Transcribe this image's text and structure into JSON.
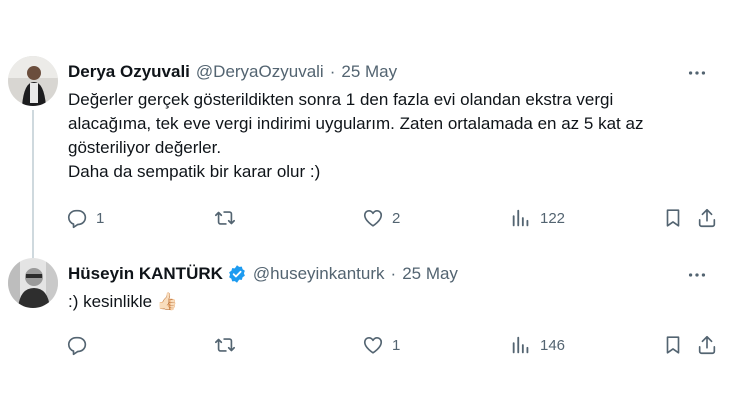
{
  "tweets": [
    {
      "display_name": "Derya Ozyuvali",
      "handle": "@DeryaOzyuvali",
      "separator": "·",
      "date": "25 May",
      "verified": false,
      "text_lines": [
        "Değerler gerçek gösterildikten sonra 1 den fazla evi olandan ekstra vergi",
        "alacağıma, tek eve vergi indirimi uygularım. Zaten ortalamada en az 5 kat az",
        "gösteriliyor değerler.",
        "Daha da sempatik bir karar olur :)"
      ],
      "replies": "1",
      "retweets": "",
      "likes": "2",
      "views": "122"
    },
    {
      "display_name": "Hüseyin KANTÜRK",
      "handle": "@huseyinkanturk",
      "separator": "·",
      "date": "25 May",
      "verified": true,
      "text_lines": [
        ":) kesinlikle"
      ],
      "emoji": "👍🏻",
      "replies": "",
      "retweets": "",
      "likes": "1",
      "views": "146"
    }
  ],
  "colors": {
    "text": "#0f1419",
    "secondary": "#536471",
    "verified": "#1d9bf0",
    "thread_line": "#cfd9de"
  }
}
